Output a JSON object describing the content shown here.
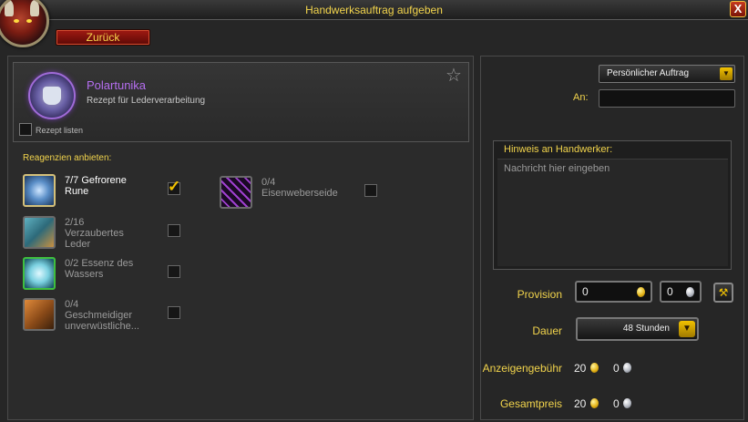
{
  "window": {
    "title": "Handwerksauftrag aufgeben",
    "close_label": "X"
  },
  "back_button": "Zurück",
  "recipe": {
    "name": "Polartunika",
    "subtitle": "Rezept für Lederverarbeitung",
    "list_recipe_label": "Rezept listen",
    "icon": "polar-tunic-icon"
  },
  "reagents_header": "Reagenzien anbieten:",
  "reagents": [
    {
      "line1": "7/7 Gefrorene",
      "line2": "Rune",
      "line3": "",
      "checked": true,
      "icon": "frozen-rune-icon",
      "color": "#ffffff"
    },
    {
      "line1": "2/16",
      "line2": "Verzaubertes",
      "line3": "Leder",
      "checked": false,
      "icon": "enchanted-leather-icon",
      "color": "#9a9a9a"
    },
    {
      "line1": "0/2 Essenz des",
      "line2": "Wassers",
      "line3": "",
      "checked": false,
      "icon": "essence-of-water-icon",
      "color": "#9a9a9a"
    },
    {
      "line1": "0/4",
      "line2": "Geschmeidiger",
      "line3": "unverwüstliche...",
      "checked": false,
      "icon": "supple-hide-icon",
      "color": "#9a9a9a"
    },
    {
      "line1": "0/4",
      "line2": "Eisenweberseide",
      "line3": "",
      "checked": false,
      "icon": "ironweb-silk-icon",
      "color": "#9a9a9a"
    }
  ],
  "order_type": {
    "selected": "Persönlicher Auftrag"
  },
  "recipient": {
    "label": "An:",
    "value": ""
  },
  "note": {
    "header": "Hinweis an Handwerker:",
    "placeholder": "Nachricht hier eingeben"
  },
  "provision": {
    "label": "Provision",
    "gold": "0",
    "silver": "0"
  },
  "duration": {
    "label": "Dauer",
    "selected": "48 Stunden"
  },
  "listing_fee": {
    "label": "Anzeigengebühr",
    "gold": "20",
    "silver": "0"
  },
  "total": {
    "label": "Gesamtpreis",
    "gold": "20",
    "silver": "0"
  },
  "colors": {
    "accent": "#f2d44c",
    "recipe_purple": "#b56ef0",
    "button_red": "#a11a12"
  }
}
